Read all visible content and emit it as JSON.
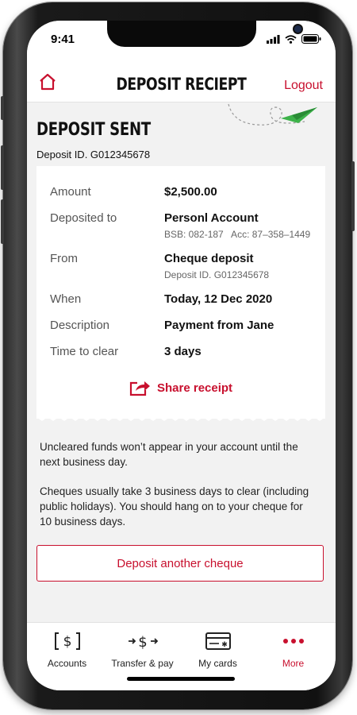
{
  "status_bar": {
    "time": "9:41"
  },
  "header": {
    "title": "DEPOSIT RECIEPT",
    "logout_label": "Logout"
  },
  "receipt": {
    "heading": "DEPOSIT SENT",
    "deposit_id_line": "Deposit ID. G012345678",
    "rows": [
      {
        "label": "Amount",
        "value": "$2,500.00",
        "sub": ""
      },
      {
        "label": "Deposited to",
        "value": "Personl Account",
        "sub": "BSB: 082-187   Acc: 87–358–1449"
      },
      {
        "label": "From",
        "value": "Cheque deposit",
        "sub": "Deposit ID. G012345678"
      },
      {
        "label": "When",
        "value": "Today, 12 Dec 2020",
        "sub": ""
      },
      {
        "label": "Description",
        "value": "Payment from Jane",
        "sub": ""
      },
      {
        "label": "Time to clear",
        "value": "3 days",
        "sub": ""
      }
    ],
    "share_label": "Share receipt"
  },
  "info": {
    "para1": "Uncleared funds won’t appear in your account until the next business day.",
    "para2": "Cheques usually take 3 business days to clear (including public holidays). You should hang on to your cheque for 10 business days."
  },
  "cta": {
    "label": "Deposit another cheque"
  },
  "tabbar": {
    "tabs": [
      {
        "label": "Accounts",
        "icon": "accounts-icon"
      },
      {
        "label": "Transfer & pay",
        "icon": "transfer-icon"
      },
      {
        "label": "My cards",
        "icon": "card-icon"
      },
      {
        "label": "More",
        "icon": "more-icon"
      }
    ],
    "active": "More"
  },
  "colors": {
    "accent": "#c8102e",
    "plane": "#3db24a",
    "background": "#f2f2f2"
  }
}
